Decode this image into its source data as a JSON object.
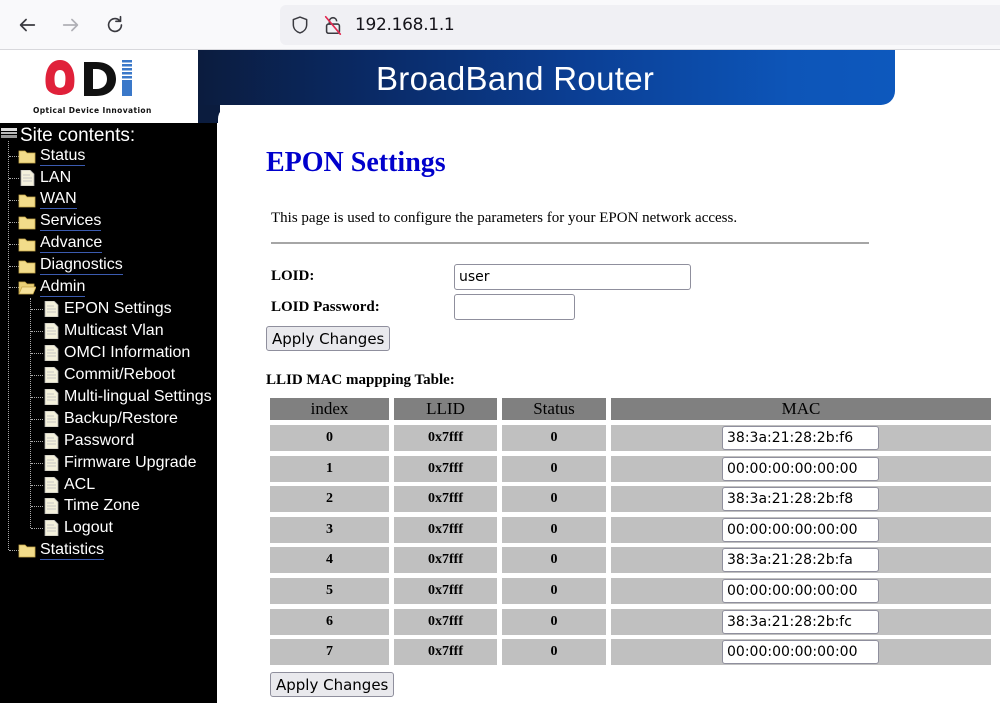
{
  "browser": {
    "url": "192.168.1.1",
    "back_icon": "arrow-left-icon",
    "forward_icon": "arrow-right-icon",
    "reload_icon": "reload-icon",
    "shield_icon": "shield-icon",
    "insecure_icon": "lock-slash-icon"
  },
  "header": {
    "logo_text": "ODI",
    "logo_subtitle": "Optical Device Innovation",
    "banner_title": "BroadBand Router",
    "colors": {
      "logo_red": "#e0213a",
      "logo_black": "#111111",
      "logo_blue": "#3a78c9",
      "banner_blue": "#0d55b8"
    }
  },
  "sidebar": {
    "title": "Site contents:",
    "items": [
      {
        "label": "Status",
        "icon": "folder-icon",
        "level": 0
      },
      {
        "label": "LAN",
        "icon": "page-icon",
        "level": 0
      },
      {
        "label": "WAN",
        "icon": "folder-icon",
        "level": 0
      },
      {
        "label": "Services",
        "icon": "folder-icon",
        "level": 0
      },
      {
        "label": "Advance",
        "icon": "folder-icon",
        "level": 0
      },
      {
        "label": "Diagnostics",
        "icon": "folder-icon",
        "level": 0
      },
      {
        "label": "Admin",
        "icon": "folder-open-icon",
        "level": 0
      },
      {
        "label": "EPON Settings",
        "icon": "page-icon",
        "level": 1
      },
      {
        "label": "Multicast Vlan",
        "icon": "page-icon",
        "level": 1
      },
      {
        "label": "OMCI Information",
        "icon": "page-icon",
        "level": 1
      },
      {
        "label": "Commit/Reboot",
        "icon": "page-icon",
        "level": 1
      },
      {
        "label": "Multi-lingual Settings",
        "icon": "page-icon",
        "level": 1
      },
      {
        "label": "Backup/Restore",
        "icon": "page-icon",
        "level": 1
      },
      {
        "label": "Password",
        "icon": "page-icon",
        "level": 1
      },
      {
        "label": "Firmware Upgrade",
        "icon": "page-icon",
        "level": 1
      },
      {
        "label": "ACL",
        "icon": "page-icon",
        "level": 1
      },
      {
        "label": "Time Zone",
        "icon": "page-icon",
        "level": 1
      },
      {
        "label": "Logout",
        "icon": "page-icon",
        "level": 1
      },
      {
        "label": "Statistics",
        "icon": "folder-icon",
        "level": 0
      }
    ]
  },
  "main": {
    "title": "EPON Settings",
    "description": "This page is used to configure the parameters for your EPON network access.",
    "loid_label": "LOID:",
    "loid_value": "user",
    "loid_password_label": "LOID Password:",
    "loid_password_value": "",
    "apply_label": "Apply Changes",
    "title_color": "#0000cc"
  },
  "llid_table": {
    "title": "LLID MAC mappping Table:",
    "columns": [
      "index",
      "LLID",
      "Status",
      "MAC"
    ],
    "rows": [
      {
        "index": "0",
        "llid": "0x7fff",
        "status": "0",
        "mac": "38:3a:21:28:2b:f6"
      },
      {
        "index": "1",
        "llid": "0x7fff",
        "status": "0",
        "mac": "00:00:00:00:00:00"
      },
      {
        "index": "2",
        "llid": "0x7fff",
        "status": "0",
        "mac": "38:3a:21:28:2b:f8"
      },
      {
        "index": "3",
        "llid": "0x7fff",
        "status": "0",
        "mac": "00:00:00:00:00:00"
      },
      {
        "index": "4",
        "llid": "0x7fff",
        "status": "0",
        "mac": "38:3a:21:28:2b:fa"
      },
      {
        "index": "5",
        "llid": "0x7fff",
        "status": "0",
        "mac": "00:00:00:00:00:00"
      },
      {
        "index": "6",
        "llid": "0x7fff",
        "status": "0",
        "mac": "38:3a:21:28:2b:fc"
      },
      {
        "index": "7",
        "llid": "0x7fff",
        "status": "0",
        "mac": "00:00:00:00:00:00"
      }
    ],
    "apply_label": "Apply Changes"
  }
}
